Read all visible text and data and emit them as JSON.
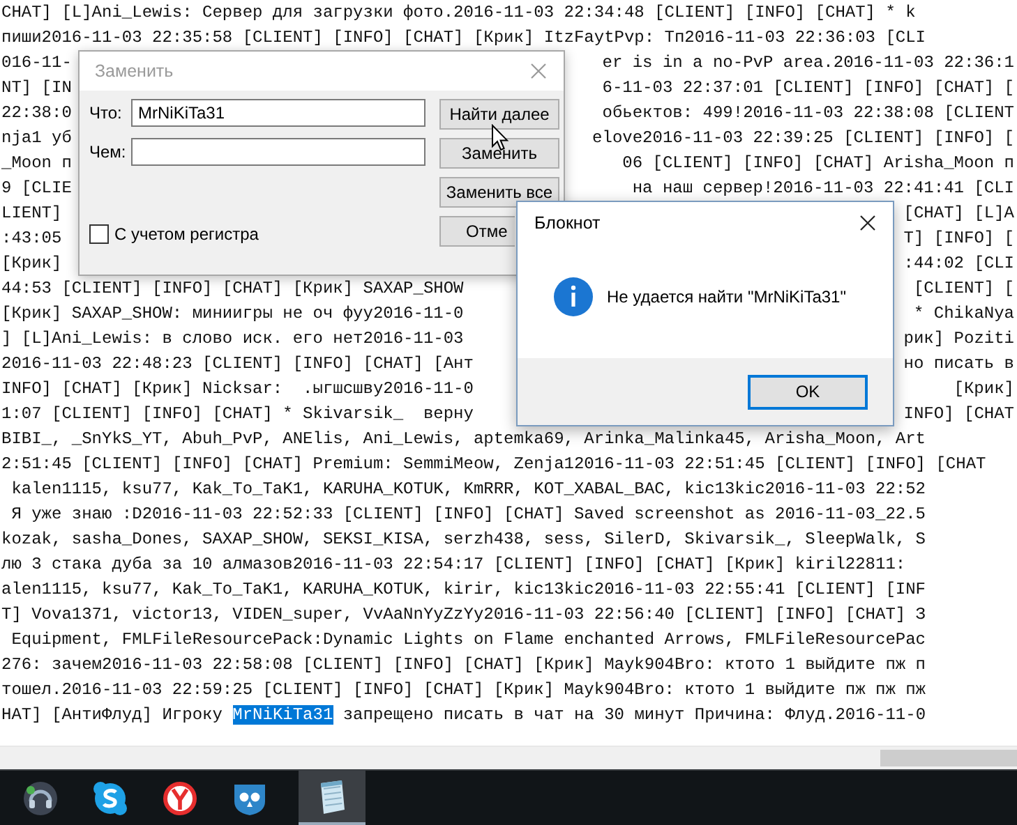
{
  "editor": {
    "lines": [
      {
        "text": "CHAT] [L]Ani_Lewis: Сервер для загрузки фото.2016-11-03 22:34:48 [CLIENT] [INFO] [CHAT] * k"
      },
      {
        "text": "пиши2016-11-03 22:35:58 [CLIENT] [INFO] [CHAT] [Крик] ItzFaytPvp: Тп2016-11-03 22:36:03 [CLI"
      },
      {
        "text": "016-11-",
        "right": "er is in a no-PvP area.2016-11-03 22:36:1"
      },
      {
        "text": "NT] [IN",
        "right": "6-11-03 22:37:01 [CLIENT] [INFO] [CHAT] ["
      },
      {
        "text": "22:38:0",
        "right": "обьектов: 499!2016-11-03 22:38:08 [CLIENT"
      },
      {
        "text": "nja1 уб",
        "right": "elove2016-11-03 22:39:25 [CLIENT] [INFO] ["
      },
      {
        "text": "_Moon п",
        "right": "06 [CLIENT] [INFO] [CHAT] Arisha_Moon п"
      },
      {
        "text": "9 [CLIE",
        "right": "на наш сервер!2016-11-03 22:41:41 [CLI"
      },
      {
        "text": "LIENT]",
        "right": "[CHAT] [L]A"
      },
      {
        "text": ":43:05",
        "right": "T] [INFO] ["
      },
      {
        "text": "[Крик]",
        "right": ":44:02 [CLI"
      },
      {
        "text": "44:53 [CLIENT] [INFO] [CHAT] [Крик] SAXAP_SHOW",
        "right": "[CLIENT] ["
      },
      {
        "text": "[Крик] SAXAP_SHOW: миниигры не оч фуу2016-11-0",
        "right": "* ChikaNya"
      },
      {
        "text": "] [L]Ani_Lewis: в слово иск. его нет2016-11-03",
        "right": "рик] Poziti"
      },
      {
        "text": "2016-11-03 22:48:23 [CLIENT] [INFO] [CHAT] [Ант",
        "right": "но писать в"
      },
      {
        "text": "INFO] [CHAT] [Крик] Nicksar:  .ыгшсшву2016-11-0",
        "right": "[Крик]"
      },
      {
        "text": "1:07 [CLIENT] [INFO] [CHAT] * Skivarsik_  верну",
        "right": "INFO] [CHAT"
      },
      {
        "text": "BIBI_, _SnYkS_YT, Abuh_PvP, ANElis, Ani_Lewis, aptemka69, Arinka_Malinka45, Arisha_Moon, Art"
      },
      {
        "text": "2:51:45 [CLIENT] [INFO] [CHAT] Premium: SemmiMeow, Zenja12016-11-03 22:51:45 [CLIENT] [INFO] [CHAT"
      },
      {
        "text": " kalen1115, ksu77, Kak_To_TaK1, KARUHA_KOTUK, KmRRR, KOT_XABAL_BAC, kic13kic2016-11-03 22:52"
      },
      {
        "text": " Я уже знаю :D2016-11-03 22:52:33 [CLIENT] [INFO] [CHAT] Saved screenshot as 2016-11-03_22.5"
      },
      {
        "text": "kozak, sasha_Dones, SAXAP_SHOW, SEKSI_KISA, serzh438, sess, SilerD, Skivarsik_, SleepWalk, S"
      },
      {
        "text": "лю 3 стака дуба за 10 алмазов2016-11-03 22:54:17 [CLIENT] [INFO] [CHAT] [Крик] kiril22811:"
      },
      {
        "text": "alen1115, ksu77, Kak_To_TaK1, KARUHA_KOTUK, kirir, kic13kic2016-11-03 22:55:41 [CLIENT] [INF"
      },
      {
        "text": "T] Vova1371, victor13, VIDEN_super, VvAaNnYyZzYy2016-11-03 22:56:40 [CLIENT] [INFO] [CHAT] З"
      },
      {
        "text": " Equipment, FMLFileResourcePack:Dynamic Lights on Flame enchanted Arrows, FMLFileResourcePac"
      },
      {
        "text": "276: зачем2016-11-03 22:58:08 [CLIENT] [INFO] [CHAT] [Крик] Mayk904Bro: ктото 1 выйдите пж п"
      },
      {
        "text": "тошел.2016-11-03 22:59:25 [CLIENT] [INFO] [CHAT] [Крик] Mayk904Bro: ктото 1 выйдите пж пж пж"
      },
      {
        "parts": [
          {
            "text": "HAT] [АнтиФлуд] Игроку ",
            "selected": false
          },
          {
            "text": "MrNiKiTa31",
            "selected": true
          },
          {
            "text": " запрещено писать в чат на 30 минут Причина: Флуд.2016-11-0",
            "selected": false
          }
        ]
      }
    ]
  },
  "find_dialog": {
    "title": "Заменить",
    "fields": [
      {
        "label": "Что:",
        "value": "MrNiKiTa31"
      },
      {
        "label": "Чем:"
      }
    ],
    "buttons": [
      "Найти далее",
      "Заменить",
      "Заменить все",
      "Отме"
    ],
    "checkbox": {
      "label": "С учетом регистра",
      "checked": false
    }
  },
  "message_box": {
    "title": "Блокнот",
    "message": "Не удается найти \"MrNiKiTa31\"",
    "button": "OK"
  },
  "taskbar": {
    "items": [
      {
        "kind": "headset",
        "selected": false
      },
      {
        "kind": "bubble",
        "selected": false
      },
      {
        "kind": "browser",
        "selected": false
      },
      {
        "kind": "shield",
        "selected": false
      },
      {
        "kind": "notepad",
        "selected": true
      }
    ]
  }
}
